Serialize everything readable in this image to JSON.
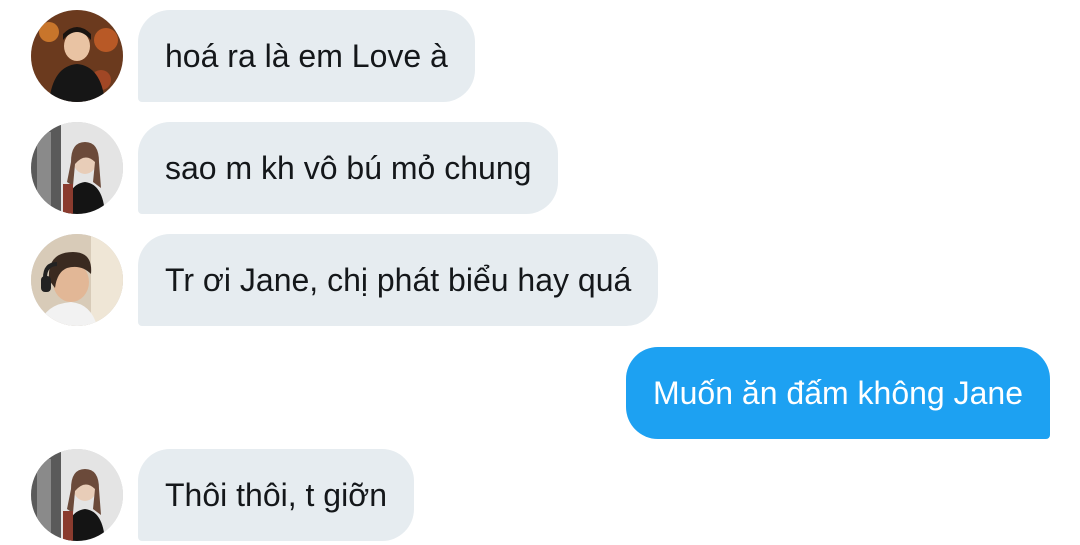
{
  "colors": {
    "incoming_bubble": "#e6ecf0",
    "incoming_text": "#14171a",
    "outgoing_bubble": "#1da1f2",
    "outgoing_text": "#ffffff"
  },
  "messages": [
    {
      "direction": "incoming",
      "avatar": "user-avatar-1",
      "text": "hoá ra là em Love à"
    },
    {
      "direction": "incoming",
      "avatar": "user-avatar-2",
      "text": "sao m kh vô bú mỏ chung"
    },
    {
      "direction": "incoming",
      "avatar": "user-avatar-3",
      "text": "Tr ơi Jane, chị phát biểu hay quá"
    },
    {
      "direction": "outgoing",
      "text": "Muốn ăn đấm không Jane"
    },
    {
      "direction": "incoming",
      "avatar": "user-avatar-2",
      "text": "Thôi thôi, t giỡn"
    }
  ]
}
